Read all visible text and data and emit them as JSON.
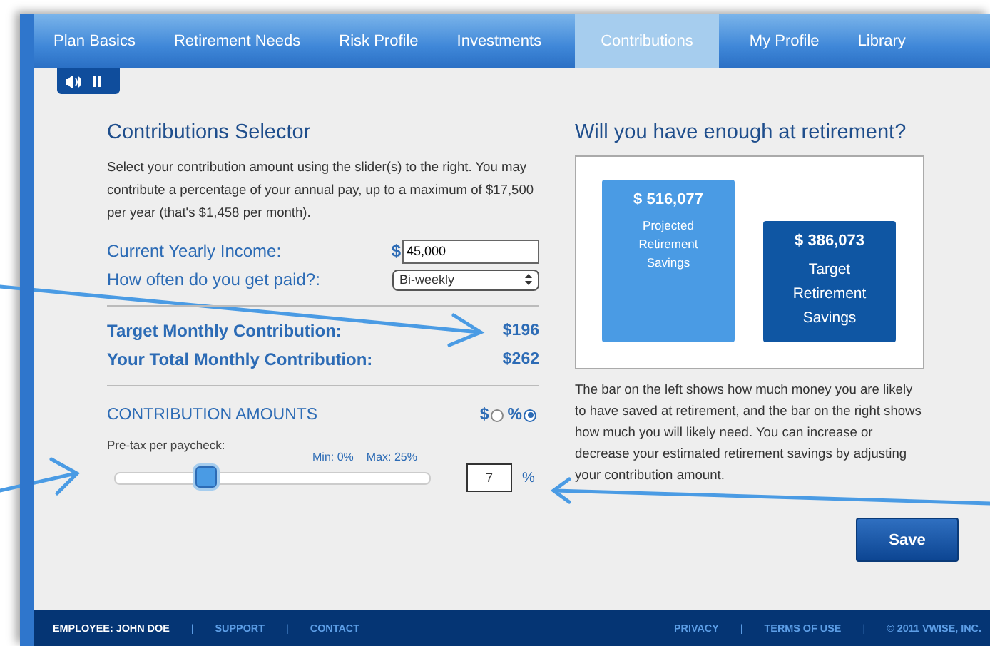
{
  "nav": {
    "tabs": [
      {
        "label": "Plan Basics",
        "selected": false
      },
      {
        "label": "Retirement Needs",
        "selected": false
      },
      {
        "label": "Risk Profile",
        "selected": false
      },
      {
        "label": "Investments",
        "selected": false
      },
      {
        "label": "Contributions",
        "selected": true
      },
      {
        "label": "My Profile",
        "selected": false
      },
      {
        "label": "Library",
        "selected": false
      }
    ]
  },
  "selector": {
    "title": "Contributions Selector",
    "description": "Select your contribution amount using the slider(s) to the right. You may contribute a percentage of your annual pay, up to a maximum of $17,500 per year (that's $1,458 per month).",
    "income": {
      "label": "Current Yearly Income:",
      "currency": "$",
      "value": "45,000"
    },
    "pay_frequency": {
      "label": "How often do you get paid?:",
      "value": "Bi-weekly"
    },
    "totals": [
      {
        "label": "Target Monthly Contribution:",
        "value": "$196"
      },
      {
        "label": "Your Total Monthly Contribution:",
        "value": "$262"
      }
    ],
    "amounts": {
      "title": "CONTRIBUTION AMOUNTS",
      "unit_options": [
        {
          "label": "$",
          "selected": false
        },
        {
          "label": "%",
          "selected": true
        }
      ],
      "slider": {
        "label": "Pre-tax per paycheck:",
        "min_label": "Min: 0%",
        "max_label": "Max: 25%",
        "level": 0.28,
        "value": "7",
        "unit": "%"
      }
    }
  },
  "outlook": {
    "title": "Will you have enough at retirement?",
    "bars": [
      {
        "amount": "$ 516,077",
        "label": "Projected Retirement Savings",
        "color": "#4a9be4"
      },
      {
        "amount": "$ 386,073",
        "label": "Target Retirement Savings",
        "color": "#0f56a3"
      }
    ],
    "description": "The bar on the left shows how much money you are likely to have saved at retirement, and the bar on the right shows how much you will likely need. You can increase or decrease your estimated retirement savings by adjusting your contribution amount.",
    "save_label": "Save"
  },
  "footer": {
    "separator": "|",
    "left": [
      {
        "label": "EMPLOYEE: JOHN DOE",
        "kind": "text"
      },
      {
        "label": "SUPPORT",
        "kind": "link"
      },
      {
        "label": "CONTACT",
        "kind": "link"
      }
    ],
    "right": [
      {
        "label": "PRIVACY",
        "kind": "link"
      },
      {
        "label": "TERMS OF USE",
        "kind": "link"
      },
      {
        "label": "© 2011 VWISE, INC.",
        "kind": "link"
      }
    ]
  }
}
